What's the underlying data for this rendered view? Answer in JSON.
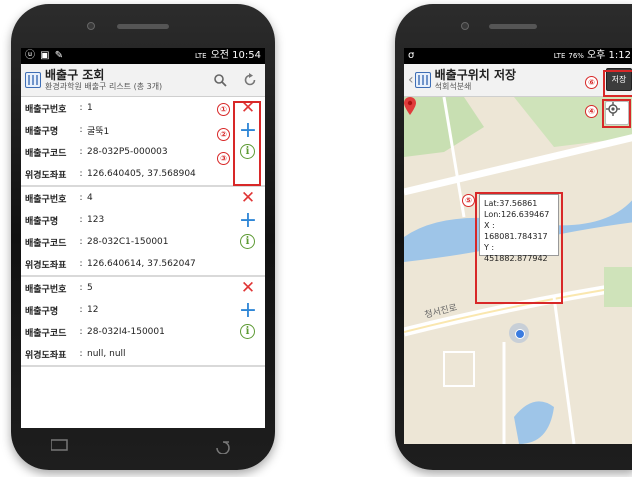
{
  "left_phone": {
    "status_time": "오전 10:54",
    "status_indicators": "LTE",
    "header": {
      "title": "배출구 조회",
      "subtitle": "환경과학원 배출구 리스트 (총 3개)"
    },
    "records": [
      {
        "fields": [
          {
            "label": "배출구번호",
            "value": "1"
          },
          {
            "label": "배출구명",
            "value": "굴뚝1"
          },
          {
            "label": "배출구코드",
            "value": "28-032P5-000003"
          },
          {
            "label": "위경도좌표",
            "value": "126.640405, 37.568904"
          }
        ]
      },
      {
        "fields": [
          {
            "label": "배출구번호",
            "value": "4"
          },
          {
            "label": "배출구명",
            "value": "123"
          },
          {
            "label": "배출구코드",
            "value": "28-032C1-150001"
          },
          {
            "label": "위경도좌표",
            "value": "126.640614, 37.562047"
          }
        ]
      },
      {
        "fields": [
          {
            "label": "배출구번호",
            "value": "5"
          },
          {
            "label": "배출구명",
            "value": "12"
          },
          {
            "label": "배출구코드",
            "value": "28-032I4-150001"
          },
          {
            "label": "위경도좌표",
            "value": "null, null"
          }
        ]
      }
    ],
    "separator": ":",
    "action_icons": {
      "delete": "✕",
      "add": "+",
      "info": "i"
    },
    "annotations": [
      "①",
      "②",
      "③"
    ]
  },
  "right_phone": {
    "status_time": "오후 1:12",
    "status_battery": "76%",
    "status_indicators": "LTE",
    "header": {
      "title": "배출구위치 저장",
      "subtitle": "석회석분쇄"
    },
    "save_label": "저장",
    "coords": {
      "lat": "Lat:37.56861",
      "lon": "Lon:126.639467",
      "x": "X : 168081.784317",
      "y": "Y : 451882.877942"
    },
    "road_label": "청서진로",
    "annotations": {
      "four": "④",
      "five": "⑤",
      "six": "⑥"
    }
  },
  "colors": {
    "delete": "#e03535",
    "add": "#2e86d6",
    "info": "#5c9a33",
    "annotation": "#d82828",
    "river": "#9ec5e8",
    "park": "#c8dfb2"
  },
  "icons": {
    "search": "search-icon",
    "refresh": "refresh-icon",
    "location": "my-location-icon",
    "pin": "map-pin-icon"
  }
}
